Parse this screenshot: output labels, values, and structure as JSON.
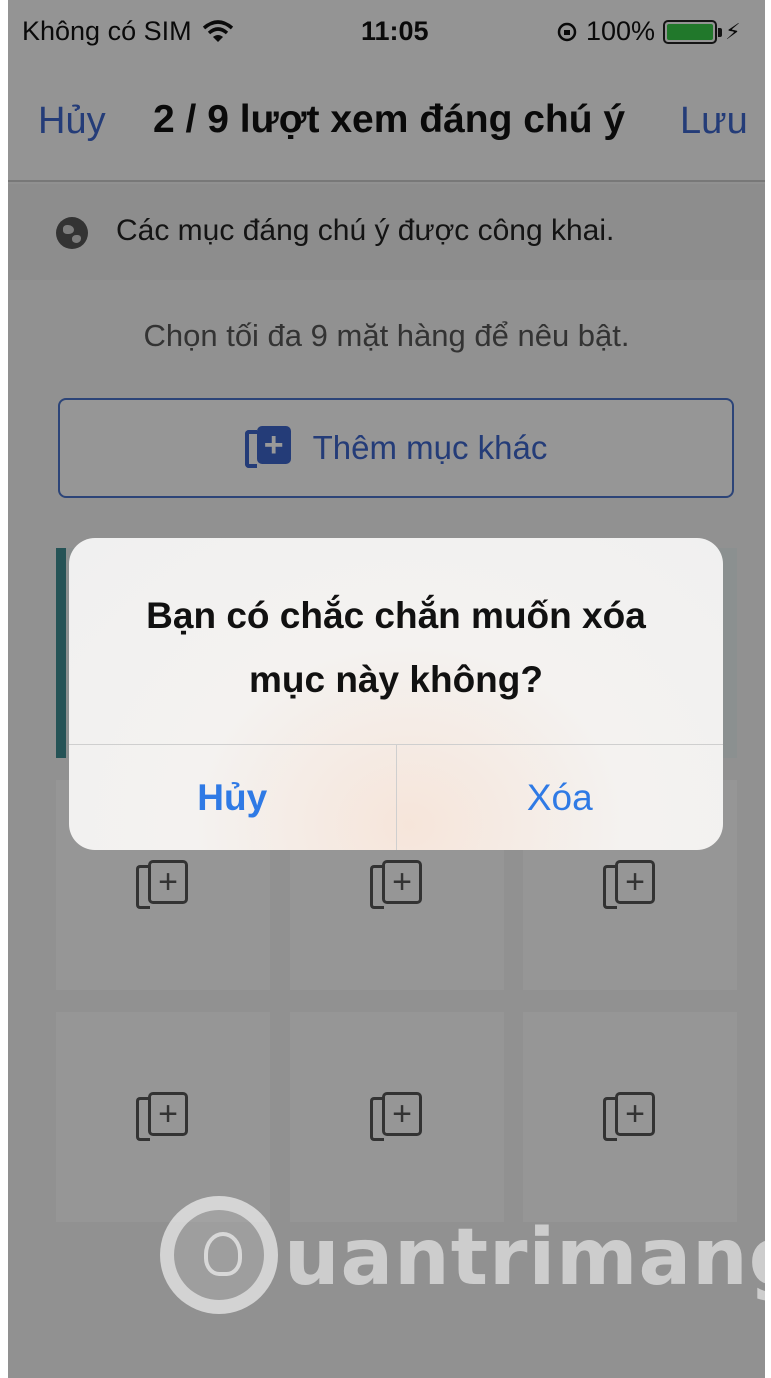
{
  "status_bar": {
    "carrier": "Không có SIM",
    "time": "11:05",
    "battery": "100%",
    "battery_level": 1.0,
    "icons": [
      "wifi-icon",
      "rotation-lock-icon",
      "battery-icon",
      "charging-bolt-icon"
    ]
  },
  "nav": {
    "cancel_label": "Hủy",
    "title": "2 / 9 lượt xem đáng chú ý",
    "save_label": "Lưu"
  },
  "notice": {
    "icon": "globe-icon",
    "text": "Các mục đáng chú ý được công khai."
  },
  "helper_text": "Chọn tối đa 9 mặt hàng để nêu bật.",
  "add_more": {
    "icon": "add-photo-icon",
    "label": "Thêm mục khác"
  },
  "grid": {
    "tiles": [
      {
        "state": "selected"
      },
      {
        "state": "selected"
      },
      {
        "state": "selected"
      },
      {
        "state": "empty",
        "icon": "add-photo-icon"
      },
      {
        "state": "empty",
        "icon": "add-photo-icon"
      },
      {
        "state": "empty",
        "icon": "add-photo-icon"
      },
      {
        "state": "empty",
        "icon": "add-photo-icon"
      },
      {
        "state": "empty",
        "icon": "add-photo-icon"
      },
      {
        "state": "empty",
        "icon": "add-photo-icon"
      }
    ]
  },
  "dialog": {
    "message_line1": "Bạn có chắc chắn muốn xóa",
    "message_line2": "mục này không?",
    "cancel_label": "Hủy",
    "delete_label": "Xóa"
  },
  "watermark": {
    "text": "uantrimang"
  },
  "colors": {
    "accent": "#3c64c8",
    "alert_button": "#2f7ae5",
    "selected_border": "#3f8b8f"
  }
}
